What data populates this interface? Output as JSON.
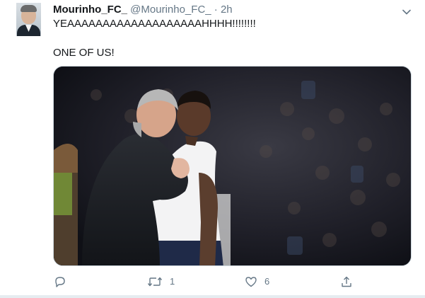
{
  "tweet": {
    "display_name": "Mourinho_FC_",
    "handle": "@Mourinho_FC_",
    "separator": "·",
    "time": "2h",
    "lines": [
      "YEAAAAAAAAAAAAAAAAAAAHHHH!!!!!!!!",
      "ONE OF US!"
    ]
  },
  "actions": {
    "reply_count": "",
    "retweet_count": "1",
    "like_count": "6"
  },
  "icons": {
    "more": "chevron-down-icon",
    "reply": "reply-icon",
    "retweet": "retweet-icon",
    "like": "heart-icon",
    "share": "share-icon"
  },
  "colors": {
    "name": "#14171a",
    "secondary": "#657786",
    "border": "#e6ecf0"
  }
}
